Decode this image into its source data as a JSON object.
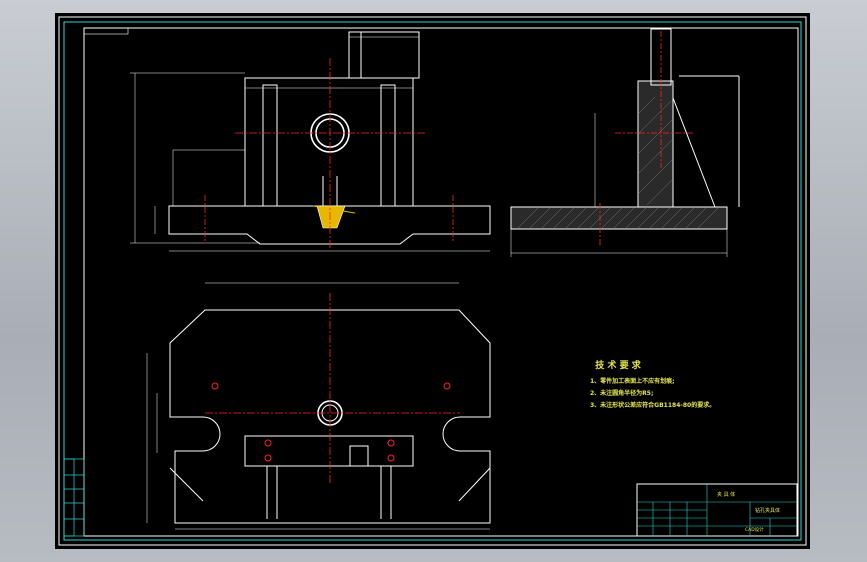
{
  "notes": {
    "title": "技 术 要 求",
    "items": [
      "1、零件加工表面上不应有划痕;",
      "2、未注圆角半径为R5;",
      "3、未注形状公差应符合GB1184-80的要求。"
    ]
  },
  "title_block": {
    "part_name": "夹 具 体",
    "drawing_id": "钻孔夹具体",
    "organization": "CAD设计"
  },
  "colors": {
    "background": "#000000",
    "outline": "#ffffff",
    "centerline": "#ff2222",
    "annotation": "#e6e64a",
    "frame": "#2ad7d0"
  }
}
